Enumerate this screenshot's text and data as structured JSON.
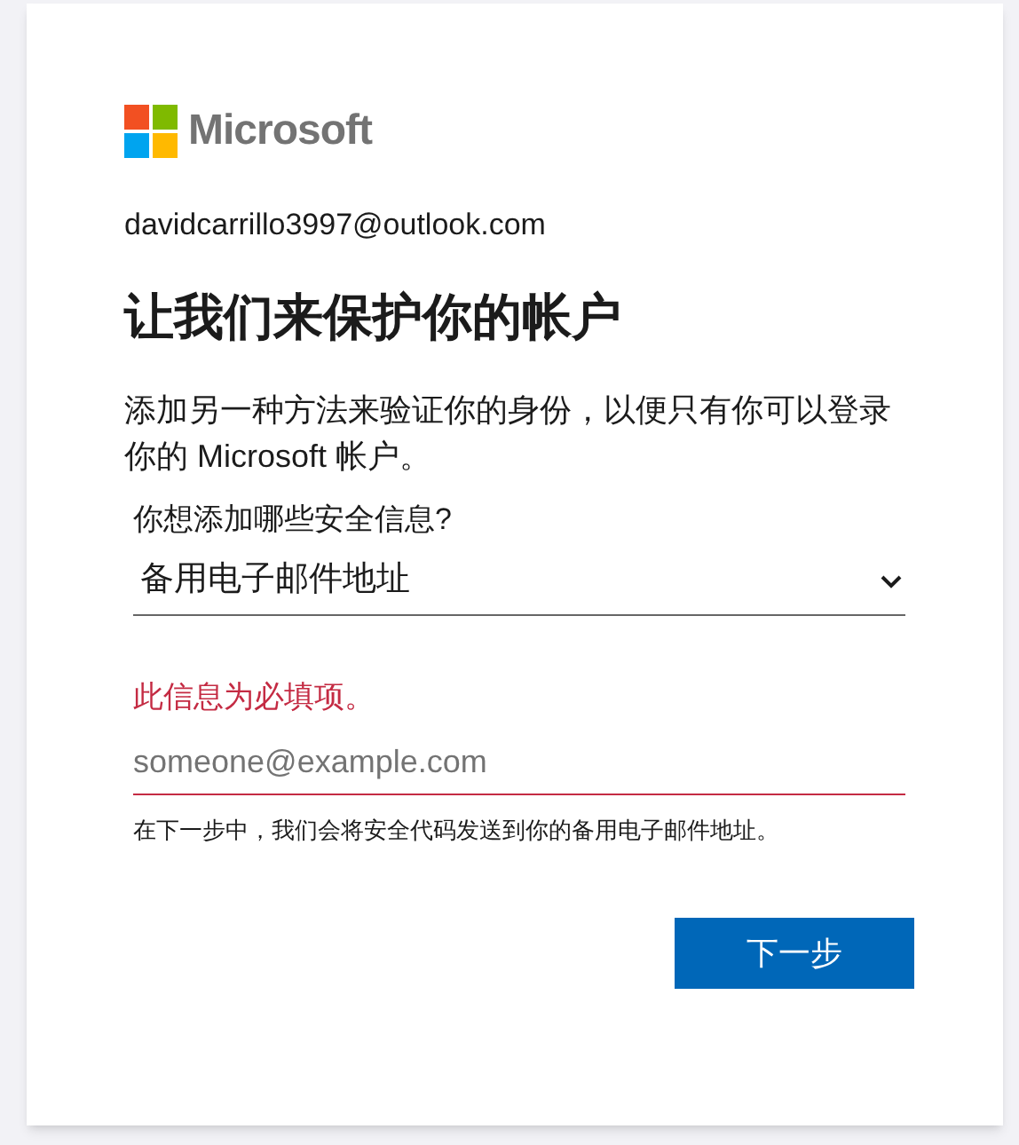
{
  "brand": {
    "name": "Microsoft"
  },
  "account": "davidcarrillo3997@outlook.com",
  "title": "让我们来保护你的帐户",
  "description": "添加另一种方法来验证你的身份，以便只有你可以登录你的 Microsoft 帐户。",
  "method_select": {
    "label": "你想添加哪些安全信息?",
    "value": "备用电子邮件地址"
  },
  "email_field": {
    "error": "此信息为必填项。",
    "placeholder": "someone@example.com",
    "invalid": true
  },
  "hint": "在下一步中，我们会将安全代码发送到你的备用电子邮件地址。",
  "next_button": "下一步"
}
